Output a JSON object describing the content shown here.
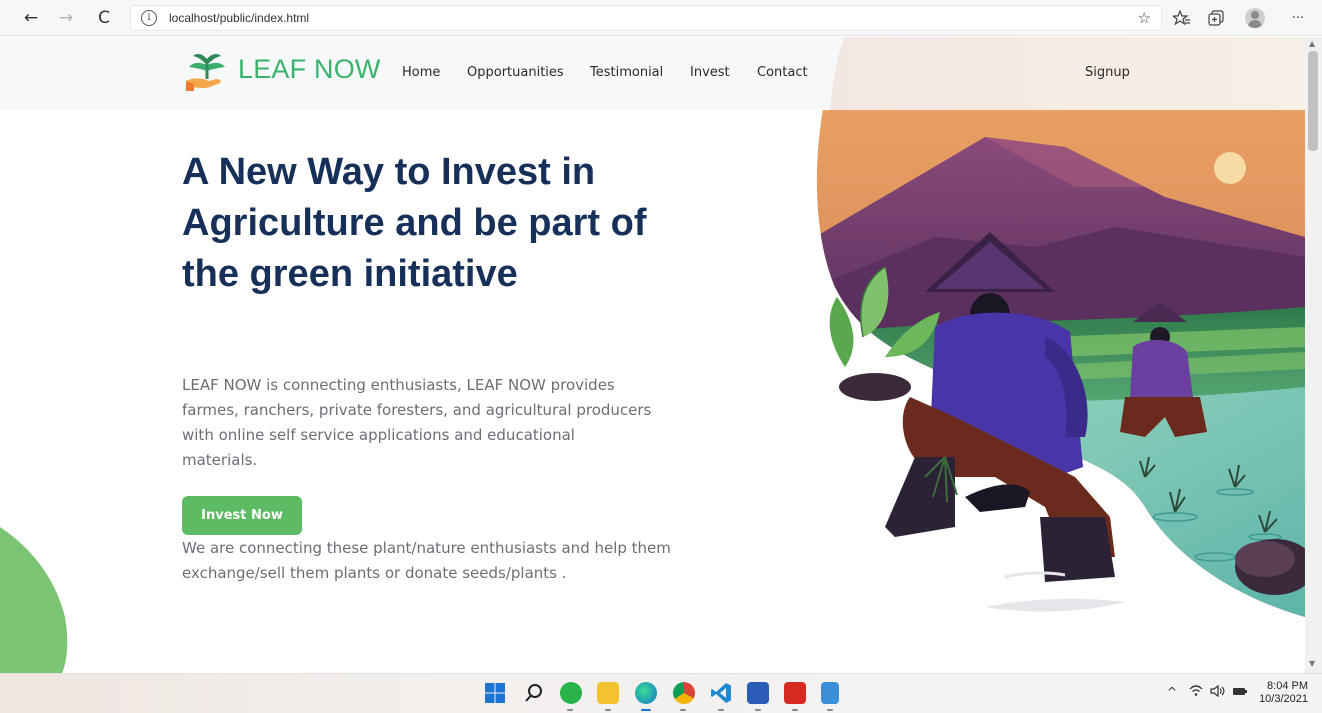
{
  "browser": {
    "url": "localhost/public/index.html",
    "back_icon": "←",
    "forward_icon": "→",
    "refresh_icon": "C",
    "info_icon": "i"
  },
  "site": {
    "brand": "LEAF NOW",
    "brand_color": "#3bb36a",
    "nav": [
      "Home",
      "Opportuanities",
      "Testimonial",
      "Invest",
      "Contact"
    ],
    "signup": "Signup"
  },
  "hero": {
    "title": "A New Way to Invest in Agriculture and be part of the green initiative",
    "description": "LEAF NOW is connecting enthusiasts, LEAF NOW provides farmes, ranchers, private foresters, and agricultural producers with online self service applications and educational materials.",
    "button": "Invest Now",
    "note": "We are connecting these plant/nature enthusiasts and help them exchange/sell them plants or donate seeds/plants .",
    "title_color": "#16305a",
    "button_color": "#5dbb63"
  },
  "taskbar": {
    "time": "8:04 PM",
    "date": "10/3/2021",
    "tray_chevron": "^"
  }
}
